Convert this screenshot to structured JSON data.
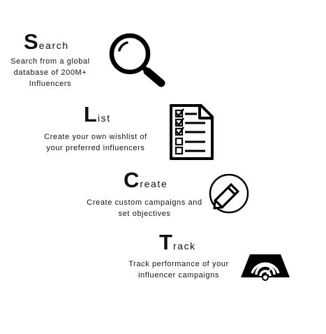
{
  "steps": [
    {
      "initial": "S",
      "rest": "earch",
      "description": "Search from a global\ndatabase of 200M+\nInfluencers",
      "icon": "magnifying-glass-icon"
    },
    {
      "initial": "L",
      "rest": "ist",
      "description": "Create your own wishlist of\nyour preferred influencers",
      "icon": "checklist-document-icon"
    },
    {
      "initial": "C",
      "rest": "reate",
      "description": "Create custom campaigns  and\nset objectives",
      "icon": "pencil-circle-icon"
    },
    {
      "initial": "T",
      "rest": "rack",
      "description": "Track performance of your\ninfluencer campaigns",
      "icon": "speed-gauge-icon"
    }
  ]
}
